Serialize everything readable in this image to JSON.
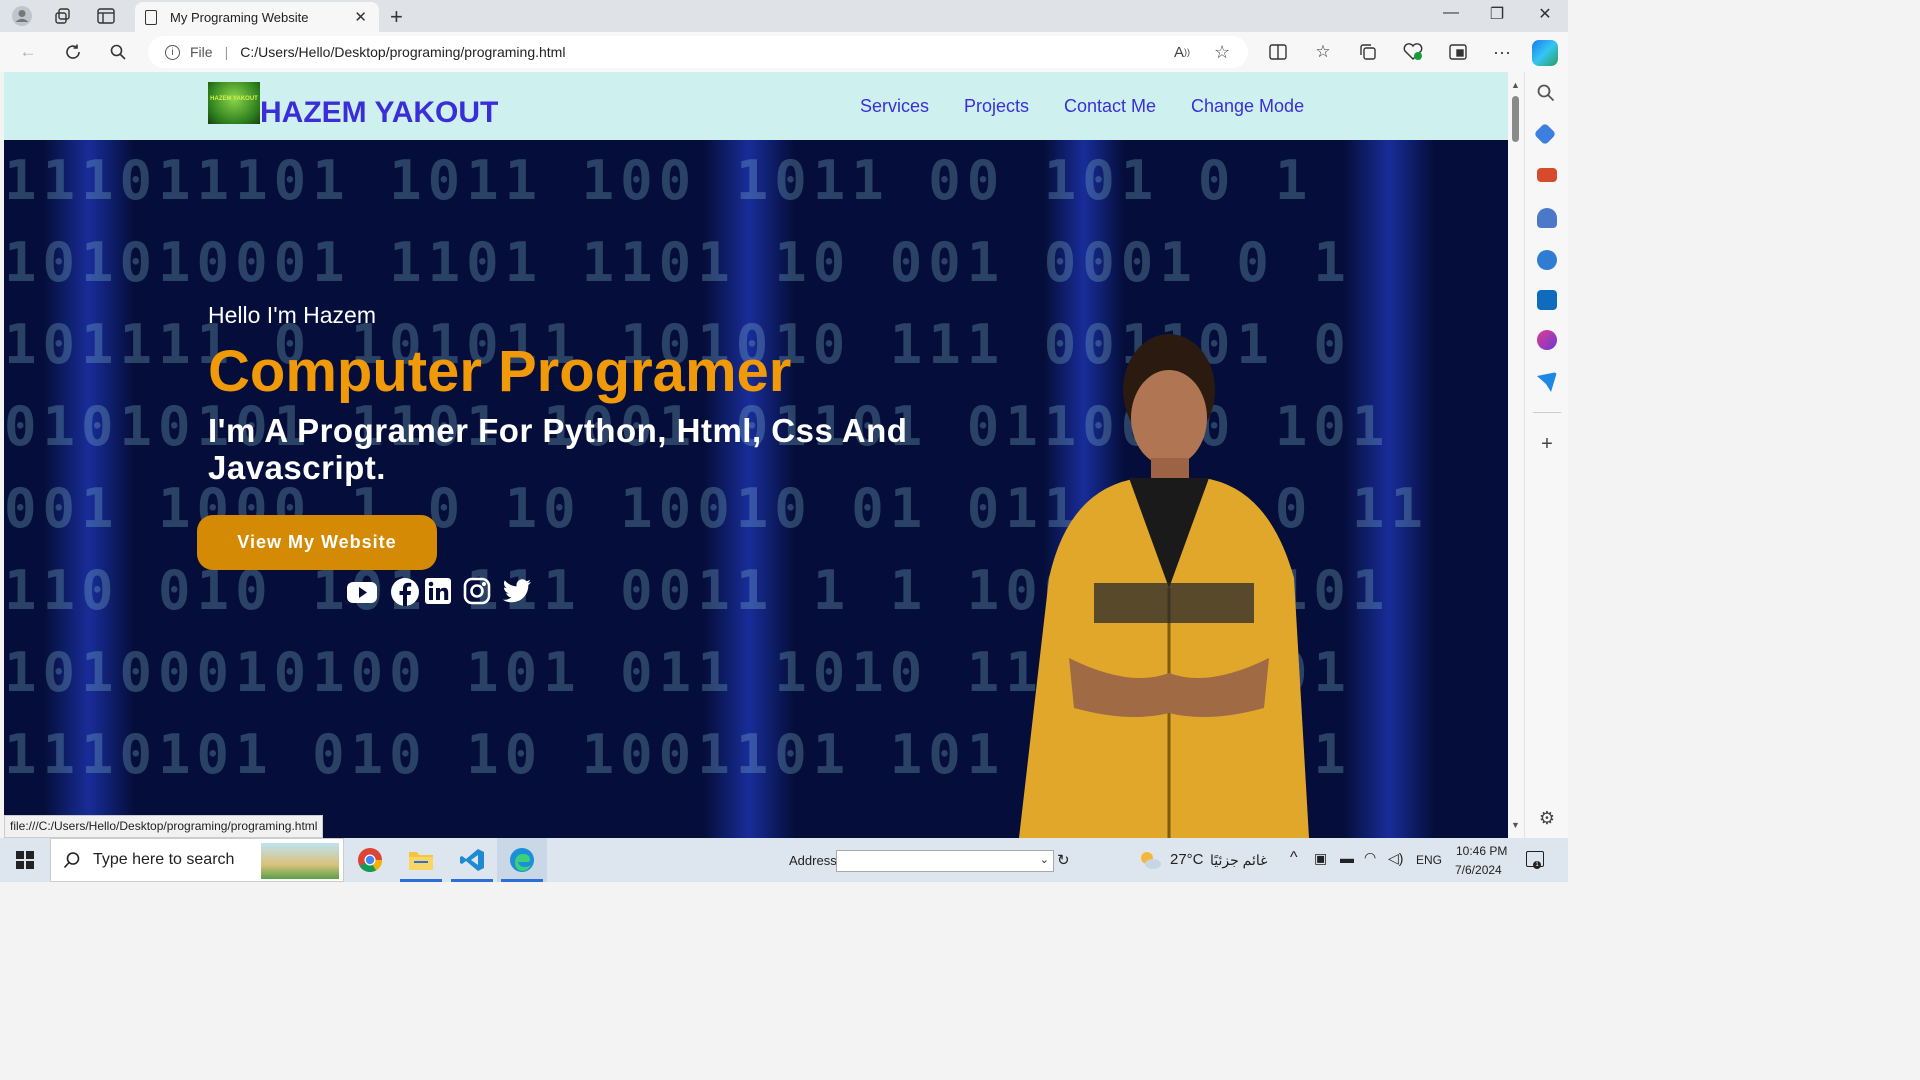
{
  "browser": {
    "tab_title": "My Programing Website",
    "address_scheme": "File",
    "address_url": "C:/Users/Hello/Desktop/programing/programing.html",
    "status_url": "file:///C:/Users/Hello/Desktop/programing/programing.html"
  },
  "site": {
    "logo_text": "HAZEM YAKOUT",
    "logo_image_text": "HAZEM YAKOUT",
    "nav": [
      "Services",
      "Projects",
      "Contact Me",
      "Change Mode"
    ],
    "hero": {
      "greeting": "Hello I'm Hazem",
      "headline": "Computer Programer",
      "tagline": "I'm A Programer For Python, Html, Css And Javascript.",
      "cta_label": "View My Website"
    },
    "social_icons": [
      "youtube-icon",
      "facebook-icon",
      "linkedin-icon",
      "instagram-icon",
      "twitter-icon"
    ],
    "colors": {
      "header_bg": "#cef1ef",
      "nav_link": "#3b2ed8",
      "headline": "#f09a0a",
      "cta_bg": "#d48a05",
      "hero_bg": "#050e3a"
    }
  },
  "taskbar": {
    "search_placeholder": "Type here to search",
    "address_label": "Address",
    "weather_temp": "27°C",
    "weather_desc": "غائم جزئيًا",
    "language": "ENG",
    "time": "10:46 PM",
    "date": "7/6/2024"
  }
}
